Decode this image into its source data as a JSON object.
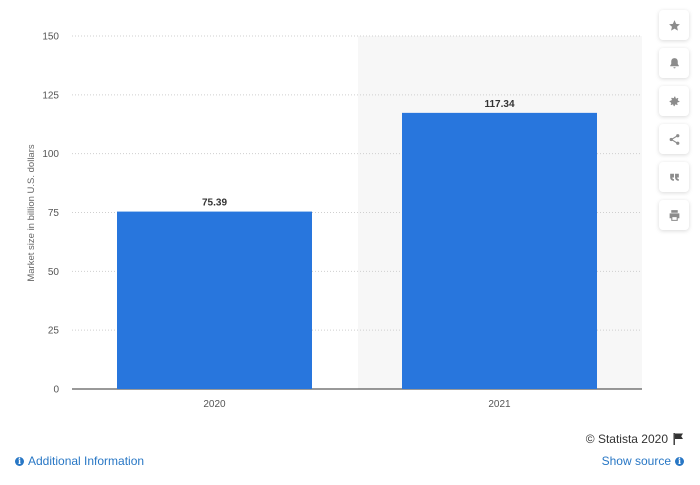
{
  "chart_data": {
    "type": "bar",
    "categories": [
      "2020",
      "2021"
    ],
    "values": [
      75.39,
      117.34
    ],
    "data_labels": [
      "75.39",
      "117.34"
    ],
    "title": "",
    "xlabel": "",
    "ylabel": "Market size in billion U.S. dollars",
    "ylim": [
      0,
      150
    ],
    "yticks": [
      "0",
      "25",
      "50",
      "75",
      "100",
      "125",
      "150"
    ],
    "ytick_values": [
      0,
      25,
      50,
      75,
      100,
      125,
      150
    ],
    "grid": true,
    "forecast_shaded_category": "2021",
    "bar_color": "#2876dd",
    "shade_color": "#f7f7f7"
  },
  "toolbar": {
    "icons": [
      "star-icon",
      "bell-icon",
      "gear-icon",
      "share-icon",
      "quote-icon",
      "print-icon"
    ]
  },
  "footer": {
    "copyright": "© Statista 2020",
    "additional_info": "Additional Information",
    "show_source": "Show source"
  },
  "colors": {
    "link": "#2877c5",
    "icon": "#8c8c8c"
  }
}
